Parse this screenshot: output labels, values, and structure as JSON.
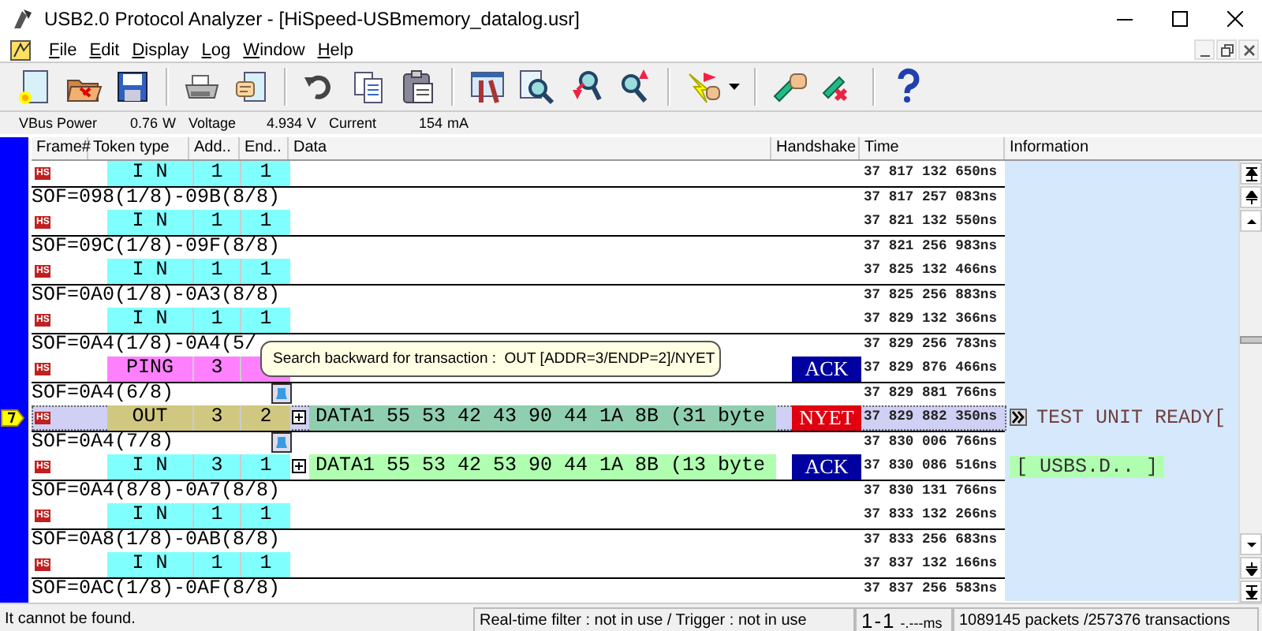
{
  "window": {
    "title": "USB2.0 Protocol Analyzer - [HiSpeed-USBmemory_datalog.usr]"
  },
  "menu": [
    "File",
    "Edit",
    "Display",
    "Log",
    "Window",
    "Help"
  ],
  "power": {
    "vbus_label": "VBus Power",
    "power": "0.76",
    "power_unit": "W",
    "voltage_label": "Voltage",
    "voltage": "4.934",
    "voltage_unit": "V",
    "current_label": "Current",
    "current": "154",
    "current_unit": "mA"
  },
  "columns": [
    "Frame#",
    "Token type",
    "Add..",
    "End..",
    "Data",
    "Handshake",
    "Time",
    "Information"
  ],
  "lines": [
    {
      "kind": "packet",
      "badge": "HS",
      "token": "I N",
      "color": "#80ffff",
      "address": "1",
      "endpoint": "1",
      "time": "37 817 132 650ns",
      "selected": false
    },
    {
      "kind": "sof",
      "text": "SOF=098(1/8)-09B(8/8)",
      "time": "37 817 257 083ns",
      "selected": false,
      "marked": false
    },
    {
      "kind": "packet",
      "badge": "HS",
      "token": "I N",
      "color": "#80ffff",
      "address": "1",
      "endpoint": "1",
      "time": "37 821 132 550ns",
      "selected": false
    },
    {
      "kind": "sof",
      "text": "SOF=09C(1/8)-09F(8/8)",
      "time": "37 821 256 983ns",
      "selected": false,
      "marked": false
    },
    {
      "kind": "packet",
      "badge": "HS",
      "token": "I N",
      "color": "#80ffff",
      "address": "1",
      "endpoint": "1",
      "time": "37 825 132 466ns",
      "selected": false
    },
    {
      "kind": "sof",
      "text": "SOF=0A0(1/8)-0A3(8/8)",
      "time": "37 825 256 883ns",
      "selected": false,
      "marked": false
    },
    {
      "kind": "packet",
      "badge": "HS",
      "token": "I N",
      "color": "#80ffff",
      "address": "1",
      "endpoint": "1",
      "time": "37 829 132 366ns",
      "selected": false
    },
    {
      "kind": "sof",
      "text": "SOF=0A4(1/8)-0A4(5/",
      "time": "37 829 256 783ns",
      "selected": false,
      "marked": false
    },
    {
      "kind": "packet",
      "badge": "HS",
      "token": "PING",
      "color": "#ff80ff",
      "address": "3",
      "handshake": {
        "text": "ACK",
        "kind": "ack"
      },
      "time": "37 829 876 466ns",
      "selected": false
    },
    {
      "kind": "sof",
      "text": "SOF=0A4(6/8)",
      "time": "37 829 881 766ns",
      "selected": false,
      "marked": true
    },
    {
      "kind": "packet",
      "badge": "HS",
      "token": "OUT",
      "color": "#d0c880",
      "address": "3",
      "endpoint": "2",
      "data": {
        "text": "DATA1 55 53 42 43 90 44 1A 8B (31 byte",
        "color": "#90ceb0",
        "expanded": false
      },
      "handshake": {
        "text": "NYET",
        "kind": "nyet"
      },
      "time": "37 829 882 350ns",
      "info": {
        "text": "TEST UNIT READY[",
        "kind": "command"
      },
      "selected": true
    },
    {
      "kind": "sof",
      "text": "SOF=0A4(7/8)",
      "time": "37 830 006 766ns",
      "selected": false,
      "marked": true
    },
    {
      "kind": "packet",
      "badge": "HS",
      "token": "I N",
      "color": "#80ffff",
      "address": "3",
      "endpoint": "1",
      "data": {
        "text": "DATA1 55 53 42 53 90 44 1A 8B (13 byte",
        "color": "#b0ffb0",
        "expanded": false
      },
      "handshake": {
        "text": "ACK",
        "kind": "ack"
      },
      "time": "37 830 086 516ns",
      "info": {
        "text": "[ USBS.D.. ]",
        "kind": "status"
      },
      "selected": false
    },
    {
      "kind": "sof",
      "text": "SOF=0A4(8/8)-0A7(8/8)",
      "time": "37 830 131 766ns",
      "selected": false,
      "marked": false
    },
    {
      "kind": "packet",
      "badge": "HS",
      "token": "I N",
      "color": "#80ffff",
      "address": "1",
      "endpoint": "1",
      "time": "37 833 132 266ns",
      "selected": false
    },
    {
      "kind": "sof",
      "text": "SOF=0A8(1/8)-0AB(8/8)",
      "time": "37 833 256 683ns",
      "selected": false,
      "marked": false
    },
    {
      "kind": "packet",
      "badge": "HS",
      "token": "I N",
      "color": "#80ffff",
      "address": "1",
      "endpoint": "1",
      "time": "37 837 132 166ns",
      "selected": false
    },
    {
      "kind": "sof",
      "text": "SOF=0AC(1/8)-0AF(8/8)",
      "time": "37 837 256 583ns",
      "selected": false,
      "marked": false
    }
  ],
  "tooltip": "Search backward for transaction :  OUT [ADDR=3/ENDP=2]/NYET",
  "status_bar": {
    "message": "It cannot be found.",
    "filter": "Real-time filter : not in use / Trigger : not in use",
    "range": "1-1",
    "duration": "-.---ms",
    "totals": "1089145 packets /257376 transactions"
  }
}
